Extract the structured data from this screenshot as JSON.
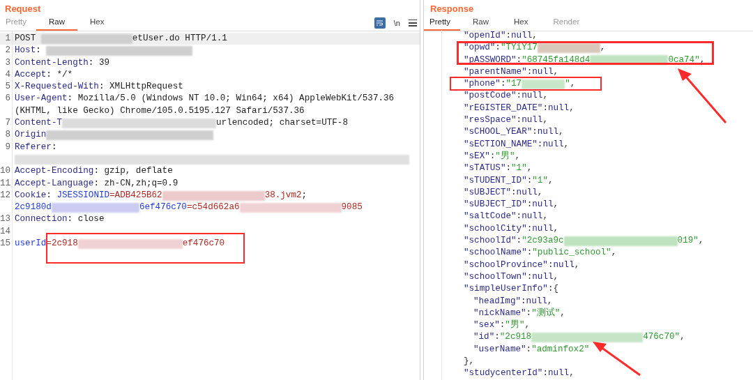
{
  "request": {
    "title": "Request",
    "tabs": [
      {
        "label": "Pretty",
        "selected": false,
        "disabled": true
      },
      {
        "label": "Raw",
        "selected": true,
        "disabled": false
      },
      {
        "label": "Hex",
        "selected": false,
        "disabled": false
      }
    ],
    "toolbar": {
      "wrap_on": true,
      "newline_label": "\\n"
    },
    "lines": [
      {
        "number": "1",
        "selected": true,
        "rows": [
          [
            {
              "kind": "text",
              "text": "POST "
            },
            {
              "kind": "redacted",
              "color": "#cfcfcf"
            },
            {
              "kind": "text",
              "text": "etUser.do HTTP/1.1"
            }
          ]
        ]
      },
      {
        "number": "2",
        "selected": false,
        "rows": [
          [
            {
              "kind": "name",
              "text": "Host"
            },
            {
              "kind": "text",
              "text": ": "
            },
            {
              "kind": "redacted",
              "color": "#cfcfcf"
            }
          ]
        ]
      },
      {
        "number": "3",
        "selected": false,
        "rows": [
          [
            {
              "kind": "name",
              "text": "Content-Length"
            },
            {
              "kind": "text",
              "text": ": 39"
            }
          ]
        ]
      },
      {
        "number": "4",
        "selected": false,
        "rows": [
          [
            {
              "kind": "name",
              "text": "Accept"
            },
            {
              "kind": "text",
              "text": ": */*"
            }
          ]
        ]
      },
      {
        "number": "5",
        "selected": false,
        "rows": [
          [
            {
              "kind": "name",
              "text": "X-Requested-With"
            },
            {
              "kind": "text",
              "text": ": XMLHttpRequest"
            }
          ]
        ]
      },
      {
        "number": "6",
        "selected": false,
        "rows": [
          [
            {
              "kind": "name",
              "text": "User-Agent"
            },
            {
              "kind": "text",
              "text": ": Mozilla/5.0 (Windows NT 10.0; Win64; x64) AppleWebKit/537.36"
            }
          ],
          [
            {
              "kind": "text",
              "text": "(KHTML, like Gecko) Chrome/105.0.5195.127 Safari/537.36"
            }
          ]
        ]
      },
      {
        "number": "7",
        "selected": false,
        "rows": [
          [
            {
              "kind": "name",
              "text": "Content-T"
            },
            {
              "kind": "redacted",
              "color": "#dcdcdc"
            },
            {
              "kind": "text",
              "text": "urlencoded; charset=UTF-8"
            }
          ]
        ]
      },
      {
        "number": "8",
        "selected": false,
        "rows": [
          [
            {
              "kind": "name",
              "text": "Origin"
            },
            {
              "kind": "redacted",
              "color": "#cfcfcf"
            }
          ]
        ]
      },
      {
        "number": "9",
        "selected": false,
        "rows": [
          [
            {
              "kind": "name",
              "text": "Referer"
            },
            {
              "kind": "text",
              "text": ":"
            }
          ],
          [
            {
              "kind": "redacted",
              "color": "#e0e0e0"
            }
          ]
        ]
      },
      {
        "number": "10",
        "selected": false,
        "rows": [
          [
            {
              "kind": "name",
              "text": "Accept-Encoding"
            },
            {
              "kind": "text",
              "text": ": gzip, deflate"
            }
          ]
        ]
      },
      {
        "number": "11",
        "selected": false,
        "rows": [
          [
            {
              "kind": "name",
              "text": "Accept-Language"
            },
            {
              "kind": "text",
              "text": ": zh-CN,zh;q=0.9"
            }
          ]
        ]
      },
      {
        "number": "12",
        "selected": false,
        "rows": [
          [
            {
              "kind": "name",
              "text": "Cookie"
            },
            {
              "kind": "text",
              "text": ": "
            },
            {
              "kind": "cookie",
              "text": "JSESSIONID"
            },
            {
              "kind": "value",
              "text": "=ADB425B62"
            },
            {
              "kind": "redacted",
              "color": "#ecc9cb"
            },
            {
              "kind": "value",
              "text": "38.jvm2"
            },
            {
              "kind": "text",
              "text": ";"
            }
          ],
          [
            {
              "kind": "cookie",
              "text": "2c9180d"
            },
            {
              "kind": "redacted",
              "color": "#ccccf2"
            },
            {
              "kind": "cookie",
              "text": "6ef476c70"
            },
            {
              "kind": "value",
              "text": "=c54d662a6"
            },
            {
              "kind": "redacted",
              "color": "#f0d2d4"
            },
            {
              "kind": "value",
              "text": "9085"
            }
          ]
        ]
      },
      {
        "number": "13",
        "selected": false,
        "rows": [
          [
            {
              "kind": "name",
              "text": "Connection"
            },
            {
              "kind": "text",
              "text": ": close"
            }
          ]
        ]
      },
      {
        "number": "14",
        "selected": false,
        "rows": [
          []
        ]
      },
      {
        "number": "15",
        "selected": false,
        "rows": [
          [
            {
              "kind": "cookie",
              "text": "userId"
            },
            {
              "kind": "value",
              "text": "=2c918"
            },
            {
              "kind": "redacted",
              "color": "#f0d2d4"
            },
            {
              "kind": "value",
              "text": "ef476c70"
            }
          ]
        ]
      }
    ]
  },
  "response": {
    "title": "Response",
    "tabs": [
      {
        "label": "Pretty",
        "selected": true,
        "disabled": false
      },
      {
        "label": "Raw",
        "selected": false,
        "disabled": false
      },
      {
        "label": "Hex",
        "selected": false,
        "disabled": false
      },
      {
        "label": "Render",
        "selected": false,
        "disabled": true
      }
    ],
    "lines": [
      {
        "tokens": [
          {
            "kind": "key",
            "text": "\"openId\""
          },
          {
            "kind": "punct",
            "text": ":"
          },
          {
            "kind": "null",
            "text": "null"
          },
          {
            "kind": "punct",
            "text": ","
          }
        ]
      },
      {
        "tokens": [
          {
            "kind": "key",
            "text": "\"opwd\""
          },
          {
            "kind": "punct",
            "text": ":"
          },
          {
            "kind": "string",
            "text": "\"TYiY17"
          },
          {
            "kind": "redacted",
            "color": "#d8c8bc"
          },
          {
            "kind": "punct",
            "text": ","
          }
        ]
      },
      {
        "tokens": [
          {
            "kind": "key",
            "text": "\"pASSWORD\""
          },
          {
            "kind": "punct",
            "text": ":"
          },
          {
            "kind": "string",
            "text": "\"68745fa148d4"
          },
          {
            "kind": "redacted",
            "color": "#c2e3c2"
          },
          {
            "kind": "string",
            "text": "0ca74\""
          },
          {
            "kind": "punct",
            "text": ","
          }
        ]
      },
      {
        "tokens": [
          {
            "kind": "key",
            "text": "\"parentName\""
          },
          {
            "kind": "punct",
            "text": ":"
          },
          {
            "kind": "null",
            "text": "null"
          },
          {
            "kind": "punct",
            "text": ","
          }
        ]
      },
      {
        "tokens": [
          {
            "kind": "key",
            "text": "\"phone\""
          },
          {
            "kind": "punct",
            "text": ":"
          },
          {
            "kind": "string",
            "text": "\"17"
          },
          {
            "kind": "redacted",
            "color": "#c8e6c8"
          },
          {
            "kind": "string",
            "text": "\""
          },
          {
            "kind": "punct",
            "text": ","
          }
        ]
      },
      {
        "tokens": [
          {
            "kind": "key",
            "text": "\"postCode\""
          },
          {
            "kind": "punct",
            "text": ":"
          },
          {
            "kind": "null",
            "text": "null"
          },
          {
            "kind": "punct",
            "text": ","
          }
        ]
      },
      {
        "tokens": [
          {
            "kind": "key",
            "text": "\"rEGISTER_DATE\""
          },
          {
            "kind": "punct",
            "text": ":"
          },
          {
            "kind": "null",
            "text": "null"
          },
          {
            "kind": "punct",
            "text": ","
          }
        ]
      },
      {
        "tokens": [
          {
            "kind": "key",
            "text": "\"resSpace\""
          },
          {
            "kind": "punct",
            "text": ":"
          },
          {
            "kind": "null",
            "text": "null"
          },
          {
            "kind": "punct",
            "text": ","
          }
        ]
      },
      {
        "tokens": [
          {
            "kind": "key",
            "text": "\"sCHOOL_YEAR\""
          },
          {
            "kind": "punct",
            "text": ":"
          },
          {
            "kind": "null",
            "text": "null"
          },
          {
            "kind": "punct",
            "text": ","
          }
        ]
      },
      {
        "tokens": [
          {
            "kind": "key",
            "text": "\"sECTION_NAME\""
          },
          {
            "kind": "punct",
            "text": ":"
          },
          {
            "kind": "null",
            "text": "null"
          },
          {
            "kind": "punct",
            "text": ","
          }
        ]
      },
      {
        "tokens": [
          {
            "kind": "key",
            "text": "\"sEX\""
          },
          {
            "kind": "punct",
            "text": ":"
          },
          {
            "kind": "string",
            "text": "\"男\""
          },
          {
            "kind": "punct",
            "text": ","
          }
        ]
      },
      {
        "tokens": [
          {
            "kind": "key",
            "text": "\"sTATUS\""
          },
          {
            "kind": "punct",
            "text": ":"
          },
          {
            "kind": "string",
            "text": "\"1\""
          },
          {
            "kind": "punct",
            "text": ","
          }
        ]
      },
      {
        "tokens": [
          {
            "kind": "key",
            "text": "\"sTUDENT_ID\""
          },
          {
            "kind": "punct",
            "text": ":"
          },
          {
            "kind": "string",
            "text": "\"1\""
          },
          {
            "kind": "punct",
            "text": ","
          }
        ]
      },
      {
        "tokens": [
          {
            "kind": "key",
            "text": "\"sUBJECT\""
          },
          {
            "kind": "punct",
            "text": ":"
          },
          {
            "kind": "null",
            "text": "null"
          },
          {
            "kind": "punct",
            "text": ","
          }
        ]
      },
      {
        "tokens": [
          {
            "kind": "key",
            "text": "\"sUBJECT_ID\""
          },
          {
            "kind": "punct",
            "text": ":"
          },
          {
            "kind": "null",
            "text": "null"
          },
          {
            "kind": "punct",
            "text": ","
          }
        ]
      },
      {
        "tokens": [
          {
            "kind": "key",
            "text": "\"saltCode\""
          },
          {
            "kind": "punct",
            "text": ":"
          },
          {
            "kind": "null",
            "text": "null"
          },
          {
            "kind": "punct",
            "text": ","
          }
        ]
      },
      {
        "tokens": [
          {
            "kind": "key",
            "text": "\"schoolCity\""
          },
          {
            "kind": "punct",
            "text": ":"
          },
          {
            "kind": "null",
            "text": "null"
          },
          {
            "kind": "punct",
            "text": ","
          }
        ]
      },
      {
        "tokens": [
          {
            "kind": "key",
            "text": "\"schoolId\""
          },
          {
            "kind": "punct",
            "text": ":"
          },
          {
            "kind": "string",
            "text": "\"2c93a9c"
          },
          {
            "kind": "redacted",
            "color": "#bfe2bf"
          },
          {
            "kind": "string",
            "text": "019\""
          },
          {
            "kind": "punct",
            "text": ","
          }
        ]
      },
      {
        "tokens": [
          {
            "kind": "key",
            "text": "\"schoolName\""
          },
          {
            "kind": "punct",
            "text": ":"
          },
          {
            "kind": "string",
            "text": "\"public_school\""
          },
          {
            "kind": "punct",
            "text": ","
          }
        ]
      },
      {
        "tokens": [
          {
            "kind": "key",
            "text": "\"schoolProvince\""
          },
          {
            "kind": "punct",
            "text": ":"
          },
          {
            "kind": "null",
            "text": "null"
          },
          {
            "kind": "punct",
            "text": ","
          }
        ]
      },
      {
        "tokens": [
          {
            "kind": "key",
            "text": "\"schoolTown\""
          },
          {
            "kind": "punct",
            "text": ":"
          },
          {
            "kind": "null",
            "text": "null"
          },
          {
            "kind": "punct",
            "text": ","
          }
        ]
      },
      {
        "tokens": [
          {
            "kind": "key",
            "text": "\"simpleUserInfo\""
          },
          {
            "kind": "punct",
            "text": ":{"
          }
        ],
        "children": [
          {
            "tokens": [
              {
                "kind": "key",
                "text": "\"headImg\""
              },
              {
                "kind": "punct",
                "text": ":"
              },
              {
                "kind": "null",
                "text": "null"
              },
              {
                "kind": "punct",
                "text": ","
              }
            ]
          },
          {
            "tokens": [
              {
                "kind": "key",
                "text": "\"nickName\""
              },
              {
                "kind": "punct",
                "text": ":"
              },
              {
                "kind": "string",
                "text": "\"测试\""
              },
              {
                "kind": "punct",
                "text": ","
              }
            ]
          },
          {
            "tokens": [
              {
                "kind": "key",
                "text": "\"sex\""
              },
              {
                "kind": "punct",
                "text": ":"
              },
              {
                "kind": "string",
                "text": "\"男\""
              },
              {
                "kind": "punct",
                "text": ","
              }
            ]
          },
          {
            "tokens": [
              {
                "kind": "key",
                "text": "\"id\""
              },
              {
                "kind": "punct",
                "text": ":"
              },
              {
                "kind": "string",
                "text": "\"2c918"
              },
              {
                "kind": "redacted",
                "color": "#c6e5c6"
              },
              {
                "kind": "string",
                "text": "476c70\""
              },
              {
                "kind": "punct",
                "text": ","
              }
            ]
          },
          {
            "tokens": [
              {
                "kind": "key",
                "text": "\"userName\""
              },
              {
                "kind": "punct",
                "text": ":"
              },
              {
                "kind": "string",
                "text": "\"adminfox2\""
              }
            ]
          }
        ]
      },
      {
        "tokens": [
          {
            "kind": "punct",
            "text": "},"
          }
        ]
      },
      {
        "tokens": [
          {
            "kind": "key",
            "text": "\"studycenterId\""
          },
          {
            "kind": "punct",
            "text": ":"
          },
          {
            "kind": "null",
            "text": "null"
          },
          {
            "kind": "punct",
            "text": ","
          }
        ]
      }
    ]
  }
}
